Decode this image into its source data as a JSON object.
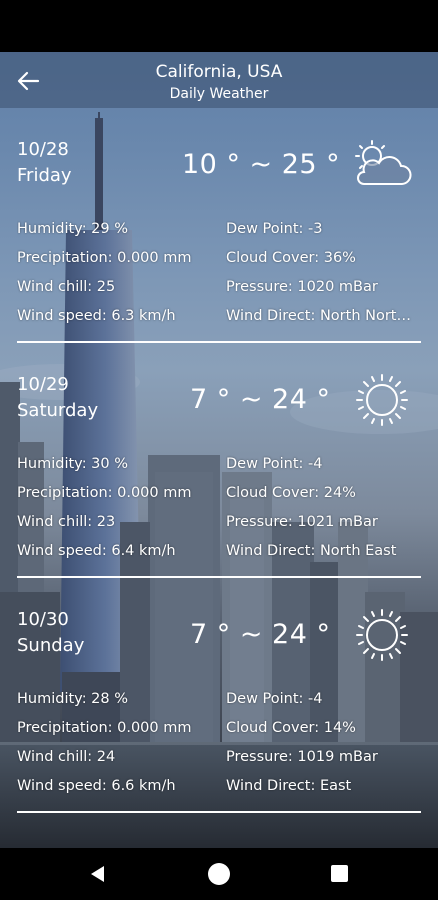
{
  "header": {
    "title": "California, USA",
    "subtitle": "Daily Weather",
    "back_icon": "arrow-left-icon"
  },
  "labels": {
    "humidity": "Humidity:",
    "precipitation": "Precipitation:",
    "wind_chill": "Wind chill:",
    "wind_speed": "Wind speed:",
    "dew_point": "Dew Point:",
    "cloud_cover": "Cloud Cover:",
    "pressure": "Pressure:",
    "wind_direct": "Wind Direct:"
  },
  "days": [
    {
      "date": "10/28",
      "weekday": "Friday",
      "temp": "10 ° ~ 25 °",
      "icon": "partly-cloudy-icon",
      "humidity": "Humidity: 29 %",
      "precipitation": "Precipitation: 0.000 mm",
      "wind_chill": "Wind chill: 25",
      "wind_speed": "Wind speed: 6.3 km/h",
      "dew_point": "Dew Point: -3",
      "cloud_cover": "Cloud Cover: 36%",
      "pressure": "Pressure: 1020 mBar",
      "wind_direct": "Wind Direct: North North..."
    },
    {
      "date": "10/29",
      "weekday": "Saturday",
      "temp": "7 ° ~ 24 °",
      "icon": "sun-icon",
      "humidity": "Humidity: 30 %",
      "precipitation": "Precipitation: 0.000 mm",
      "wind_chill": "Wind chill: 23",
      "wind_speed": "Wind speed: 6.4 km/h",
      "dew_point": "Dew Point: -4",
      "cloud_cover": "Cloud Cover: 24%",
      "pressure": "Pressure: 1021 mBar",
      "wind_direct": "Wind Direct: North East"
    },
    {
      "date": "10/30",
      "weekday": "Sunday",
      "temp": "7 ° ~ 24 °",
      "icon": "sun-icon",
      "humidity": "Humidity: 28 %",
      "precipitation": "Precipitation: 0.000 mm",
      "wind_chill": "Wind chill: 24",
      "wind_speed": "Wind speed: 6.6 km/h",
      "dew_point": "Dew Point: -4",
      "cloud_cover": "Cloud Cover: 14%",
      "pressure": "Pressure: 1019 mBar",
      "wind_direct": "Wind Direct: East"
    }
  ],
  "navbar": {
    "back_icon": "nav-back-icon",
    "home_icon": "nav-home-icon",
    "recents_icon": "nav-recents-icon"
  }
}
